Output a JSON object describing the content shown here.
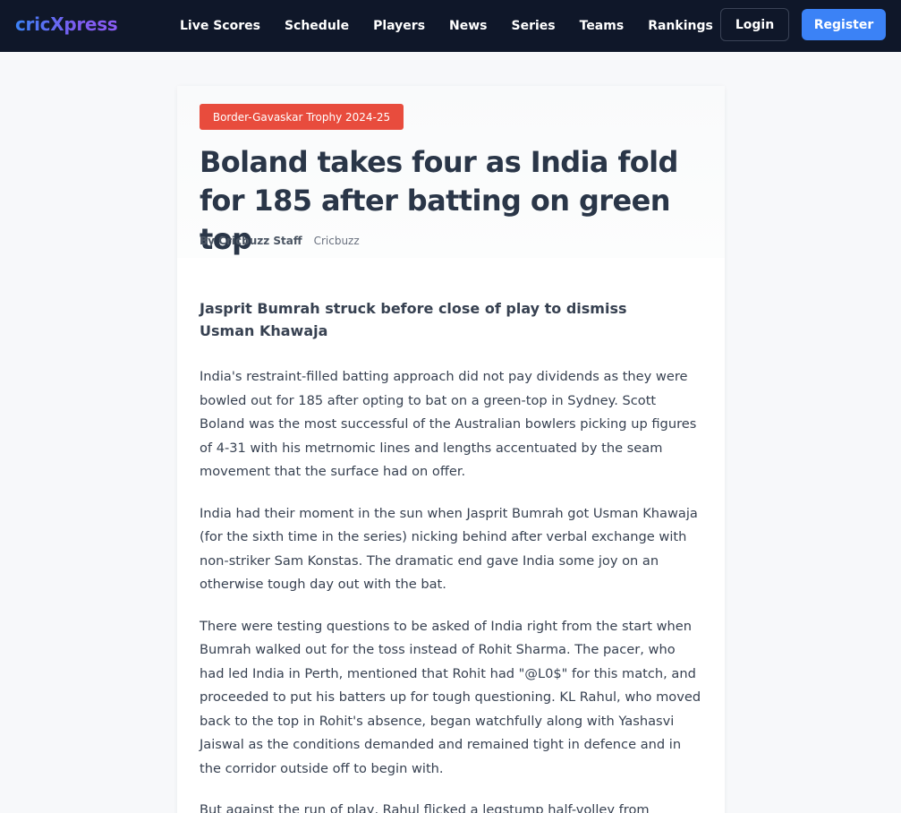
{
  "nav": {
    "brand": "cricXpress",
    "links": [
      "Live Scores",
      "Schedule",
      "Players",
      "News",
      "Series",
      "Teams",
      "Rankings"
    ],
    "login_label": "Login",
    "register_label": "Register"
  },
  "article": {
    "tag": "Border-Gavaskar Trophy 2024-25",
    "headline": "Boland takes four as India fold for 185 after batting on green top",
    "author": "By Cricbuzz Staff",
    "source": "Cricbuzz",
    "subhead": "Jasprit Bumrah struck before close of play to dismiss Usman Khawaja",
    "paragraphs": [
      "India's restraint-filled batting approach did not pay dividends as they were bowled out for 185 after opting to bat on a green-top in Sydney. Scott Boland was the most successful of the Australian bowlers picking up figures of 4-31 with his metrnomic lines and lengths accentuated by the seam movement that the surface had on offer.",
      "India had their moment in the sun when Jasprit Bumrah got Usman Khawaja (for the sixth time in the series) nicking behind after verbal exchange with non-striker Sam Konstas. The dramatic end gave India some joy on an otherwise tough day out with the bat.",
      "There were testing questions to be asked of India right from the start when Bumrah walked out for the toss instead of Rohit Sharma. The pacer, who had led India in Perth, mentioned that Rohit had \"@L0$\" for this match, and proceeded to put his batters up for tough questioning. KL Rahul, who moved back to the top in Rohit's absence, began watchfully along with Yashasvi Jaiswal as the conditions demanded and remained tight in defence and in the corridor outside off to begin with.",
      "But against the run of play, Rahul flicked a legstump half-volley from"
    ]
  },
  "colors": {
    "navbar_bg": "#0f1729",
    "accent_blue": "#3b82f6",
    "tag_red": "#e84c3d",
    "headline": "#2a3648"
  }
}
